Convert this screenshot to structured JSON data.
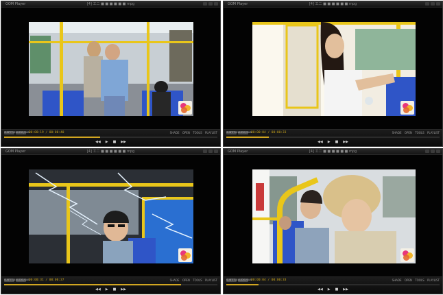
{
  "players": [
    {
      "app_name": "GOM Player",
      "title": "[4] 工二 ■ ■ ■ ■ ■ ■ mpg",
      "timecode": "00:00:19 / 00:00:40",
      "progress": 0.45,
      "scene": "bus passengers boarding",
      "buttons": {
        "sub": "SUBTITLE",
        "audio": "AUDIO/SUB"
      },
      "menu": {
        "shade": "SHADE",
        "open": "OPEN",
        "tools": "TOOLS",
        "playlist": "PLAYLIST"
      },
      "transport": {
        "prev": "◀◀",
        "play": "▶",
        "stop": "■",
        "next": "▶▶"
      }
    },
    {
      "app_name": "GOM Player",
      "title": "[4] 工二 ■ ■ ■ ■ ■ ■ mpg",
      "timecode": "00:00:04 / 00:00:33",
      "progress": 0.2,
      "scene": "woman holding pole on bus",
      "buttons": {
        "sub": "SUBTITLE",
        "audio": "AUDIO/SUB"
      },
      "menu": {
        "shade": "SHADE",
        "open": "OPEN",
        "tools": "TOOLS",
        "playlist": "PLAYLIST"
      },
      "transport": {
        "prev": "◀◀",
        "play": "▶",
        "stop": "■",
        "next": "▶▶"
      }
    },
    {
      "app_name": "GOM Player",
      "title": "[4] 工二 ■ ■ ■ ■ ■ ■ mpg",
      "timecode": "00:00:31 / 00:00:37",
      "progress": 0.83,
      "scene": "lightning effect on bus",
      "buttons": {
        "sub": "SUBTITLE",
        "audio": "AUDIO/SUB"
      },
      "menu": {
        "shade": "SHADE",
        "open": "OPEN",
        "tools": "TOOLS",
        "playlist": "PLAYLIST"
      },
      "transport": {
        "prev": "◀◀",
        "play": "▶",
        "stop": "■",
        "next": "▶▶"
      }
    },
    {
      "app_name": "GOM Player",
      "title": "[4] 工二 ■ ■ ■ ■ ■ ■ mpg",
      "timecode": "00:00:04 / 00:00:33",
      "progress": 0.15,
      "scene": "passenger leaning on shoulder",
      "buttons": {
        "sub": "SUBTITLE",
        "audio": "AUDIO/SUB"
      },
      "menu": {
        "shade": "SHADE",
        "open": "OPEN",
        "tools": "TOOLS",
        "playlist": "PLAYLIST"
      },
      "transport": {
        "prev": "◀◀",
        "play": "▶",
        "stop": "■",
        "next": "▶▶"
      }
    }
  ],
  "colors": {
    "accent": "#d2a621",
    "bus_pole_yellow": "#e9c61a",
    "seat_blue": "#2a49b8"
  }
}
